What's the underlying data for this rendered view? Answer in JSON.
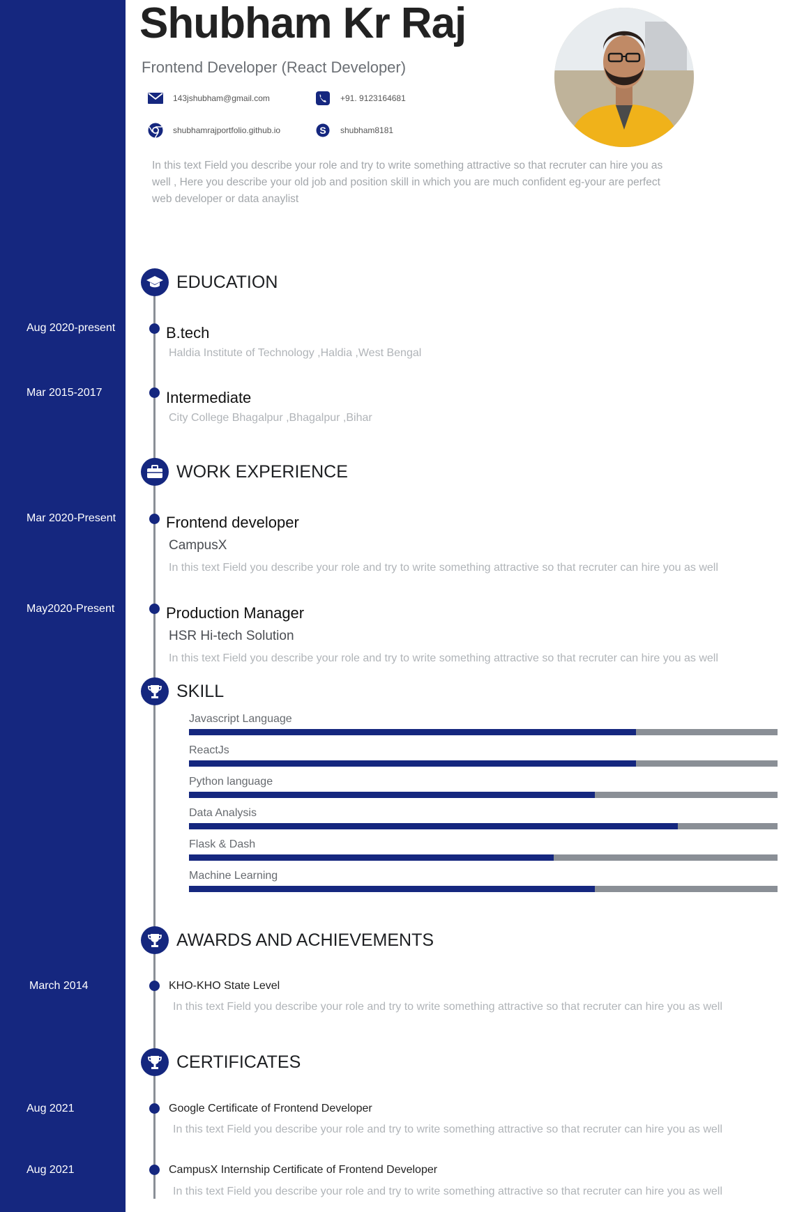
{
  "header": {
    "name": "Shubham Kr Raj",
    "title": "Frontend Developer (React Developer)",
    "intro": "In this text Field you describe your role and try to write something attractive so that recruter can hire you as well , Here you describe your old job and position skill in which you are much confident eg-your are perfect web developer or data anaylist"
  },
  "contacts": {
    "email": "143jshubham@gmail.com",
    "phone": "+91. 9123164681",
    "website": "shubhamrajportfolio.github.io",
    "skype": "shubham8181"
  },
  "sections": {
    "education": "EDUCATION",
    "work": "WORK EXPERIENCE",
    "skill": "SKILL",
    "awards": "AWARDS AND ACHIEVEMENTS",
    "certificates": "CERTIFICATES"
  },
  "education": [
    {
      "date": "Aug 2020-present",
      "degree": "B.tech",
      "school": "Haldia Institute of Technology ,Haldia ,West Bengal"
    },
    {
      "date": "Mar 2015-2017",
      "degree": "Intermediate",
      "school": "City College Bhagalpur ,Bhagalpur ,Bihar"
    }
  ],
  "work": [
    {
      "date": "Mar 2020-Present",
      "role": "Frontend developer",
      "company": "CampusX",
      "desc": "In this text Field you describe your role and try to write something attractive so that recruter can hire you as well"
    },
    {
      "date": "May2020-Present",
      "role": "Production Manager",
      "company": "HSR Hi-tech Solution",
      "desc": "In this text Field you describe your role and try to write something attractive so that recruter can hire you as well"
    }
  ],
  "skills": [
    {
      "name": "Javascript Language",
      "level": 0.76
    },
    {
      "name": "ReactJs",
      "level": 0.76
    },
    {
      "name": "Python language",
      "level": 0.69
    },
    {
      "name": "Data Analysis",
      "level": 0.83
    },
    {
      "name": "Flask & Dash",
      "level": 0.62
    },
    {
      "name": "Machine Learning",
      "level": 0.69
    }
  ],
  "awards": [
    {
      "date": "March 2014",
      "title": "KHO-KHO State Level",
      "desc": "In this text Field you describe your role and try to write something attractive so that recruter can hire you as well"
    }
  ],
  "certificates": [
    {
      "date": "Aug 2021",
      "title": "Google Certificate of Frontend Developer",
      "desc": "In this text Field you describe your role and try to write something attractive so that recruter can hire you as well"
    },
    {
      "date": "Aug 2021",
      "title": "CampusX Internship Certificate of Frontend Developer",
      "desc": "In this text Field you describe your role and try to write something attractive so that recruter can hire you as well"
    }
  ],
  "colors": {
    "accent": "#15277f",
    "track": "#8a8f96"
  },
  "icons": [
    "email-icon",
    "phone-icon",
    "chrome-icon",
    "skype-icon",
    "graduation-cap-icon",
    "briefcase-icon",
    "trophy-icon"
  ]
}
